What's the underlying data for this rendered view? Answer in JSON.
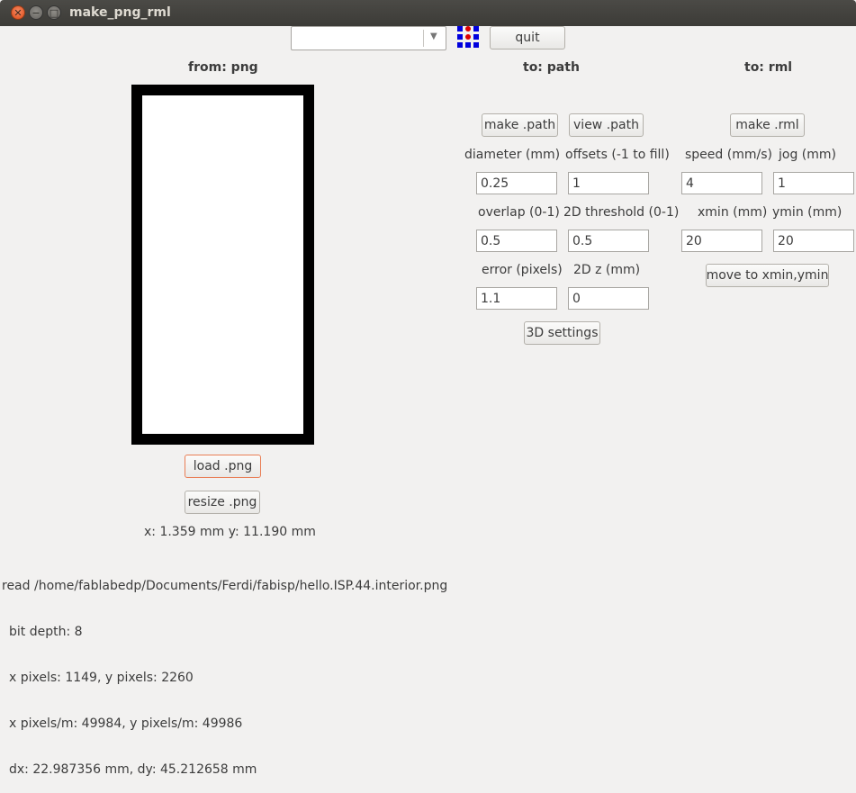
{
  "window": {
    "title": "make_png_rml"
  },
  "toolbar": {
    "combo_value": "",
    "quit_label": "quit",
    "logo_icon": "fab-logo-icon"
  },
  "headers": {
    "from": "from: png",
    "to_path": "to: path",
    "to_rml": "to: rml"
  },
  "png": {
    "load_label": "load .png",
    "resize_label": "resize .png",
    "coords": "x: 1.359 mm  y: 11.190 mm"
  },
  "path": {
    "make_label": "make .path",
    "view_label": "view .path",
    "diameter_label": "diameter (mm)",
    "diameter_value": "0.25",
    "offsets_label": "offsets (-1 to fill)",
    "offsets_value": "1",
    "overlap_label": "overlap (0-1)",
    "overlap_value": "0.5",
    "threshold_label": "2D threshold (0-1)",
    "threshold_value": "0.5",
    "error_label": "error (pixels)",
    "error_value": "1.1",
    "z_label": "2D z (mm)",
    "z_value": "0",
    "settings3d_label": "3D settings"
  },
  "rml": {
    "make_label": "make .rml",
    "speed_label": "speed (mm/s)",
    "speed_value": "4",
    "jog_label": "jog (mm)",
    "jog_value": "1",
    "xmin_label": "xmin (mm)",
    "xmin_value": "20",
    "ymin_label": "ymin (mm)",
    "ymin_value": "20",
    "move_label": "move to xmin,ymin"
  },
  "info": {
    "read_line": "read /home/fablabedp/Documents/Ferdi/fabisp/hello.ISP.44.interior.png",
    "bit_depth": "bit depth: 8",
    "pixels": "x pixels: 1149, y pixels: 2260",
    "pixels_per_m": "x pixels/m: 49984, y pixels/m: 49986",
    "dxdy": "dx: 22.987356 mm, dy: 45.212658 mm"
  }
}
